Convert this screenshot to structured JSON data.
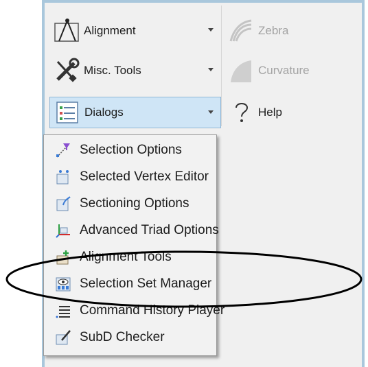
{
  "ribbon": {
    "alignment": {
      "label": "Alignment",
      "icon": "alignment-icon"
    },
    "misc_tools": {
      "label": "Misc. Tools",
      "icon": "wrench-screwdriver-icon"
    },
    "dialogs": {
      "label": "Dialogs",
      "icon": "dialogs-icon"
    },
    "zebra": {
      "label": "Zebra",
      "icon": "zebra-icon",
      "disabled": true
    },
    "curvature": {
      "label": "Curvature",
      "icon": "curvature-icon",
      "disabled": true
    },
    "help": {
      "label": "Help",
      "icon": "question-icon"
    }
  },
  "menu": {
    "items": [
      {
        "label": "Selection Options",
        "icon": "funnel-selection-icon"
      },
      {
        "label": "Selected Vertex Editor",
        "icon": "vertex-editor-icon"
      },
      {
        "label": "Sectioning Options",
        "icon": "sectioning-icon"
      },
      {
        "label": "Advanced Triad Options",
        "icon": "triad-icon"
      },
      {
        "label": "Alignment Tools",
        "icon": "alignment-tools-icon"
      },
      {
        "label": "Selection Set Manager",
        "icon": "selection-set-icon"
      },
      {
        "label": "Command History Player",
        "icon": "history-list-icon"
      },
      {
        "label": "SubD Checker",
        "icon": "checker-icon"
      }
    ]
  },
  "colors": {
    "ribbon_border": "#a9c7dc",
    "highlight": "#cfe5f6",
    "annotation": "#000000"
  }
}
